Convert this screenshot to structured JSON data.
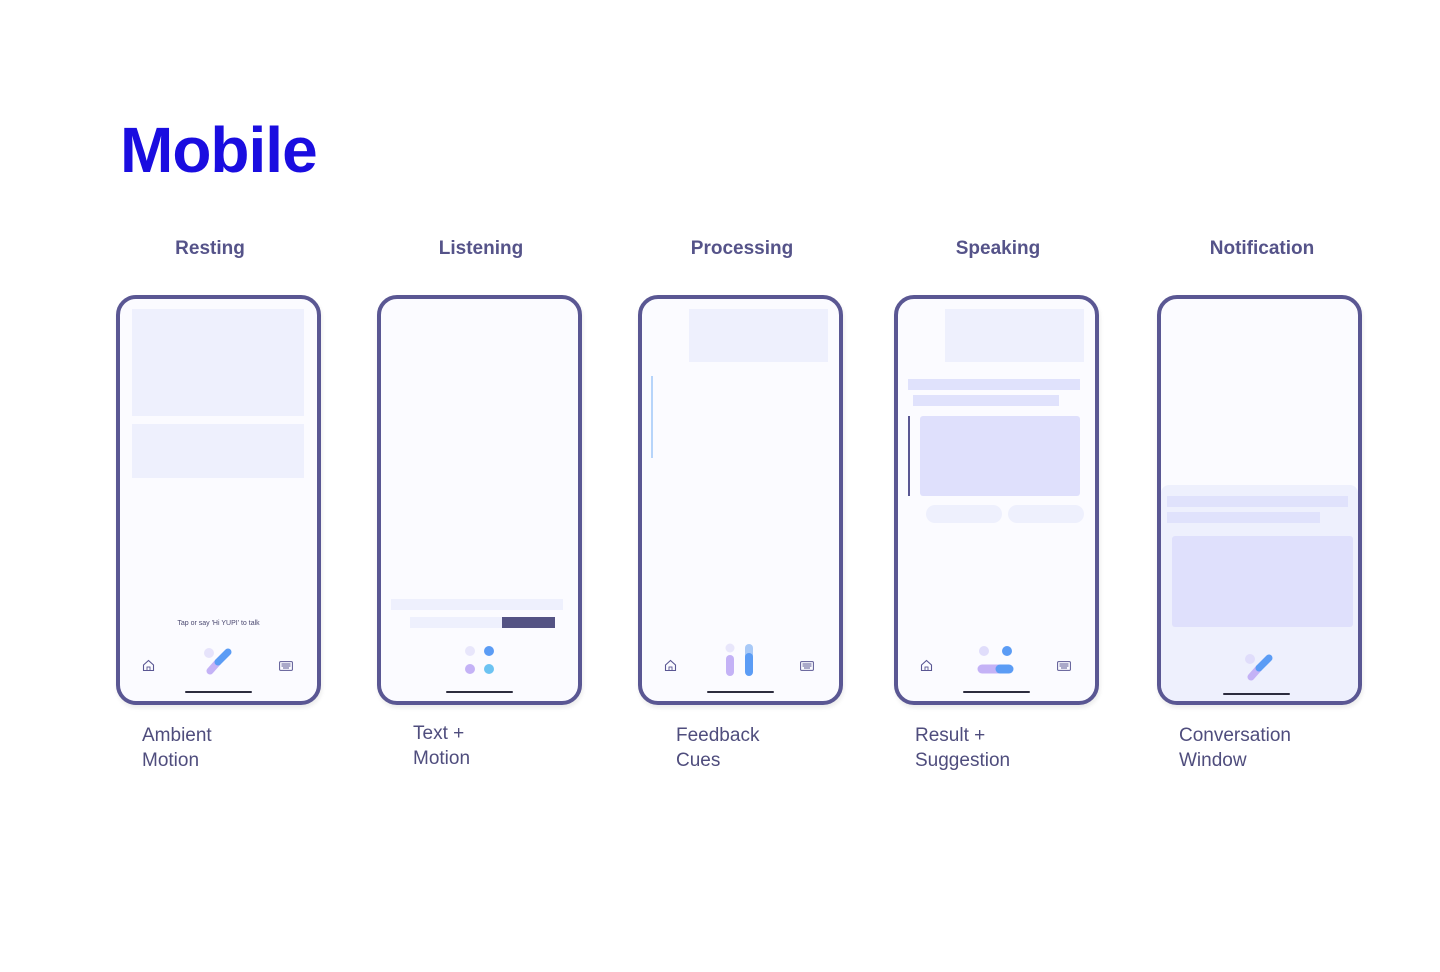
{
  "title": "Mobile",
  "states": [
    {
      "label": "Resting",
      "caption": "Ambient\nMotion"
    },
    {
      "label": "Listening",
      "caption": "Text +\nMotion"
    },
    {
      "label": "Processing",
      "caption": "Feedback\nCues"
    },
    {
      "label": "Speaking",
      "caption": "Result +\nSuggestion"
    },
    {
      "label": "Notification",
      "caption": "Conversation\nWindow"
    }
  ],
  "resting_prompt": "Tap or say 'Hi YUPI' to talk",
  "colors": {
    "title": "#1a0de0",
    "frame": "#5a5793",
    "label": "#555389",
    "block_light": "#eef0fd",
    "block_mid": "#e0e2fc",
    "accent_blue": "#5b9cf5",
    "accent_purple": "#c4b2f6",
    "bar_dark": "#545384"
  },
  "icons": [
    "home-icon",
    "keyboard-icon",
    "assistant-orb-icon"
  ]
}
